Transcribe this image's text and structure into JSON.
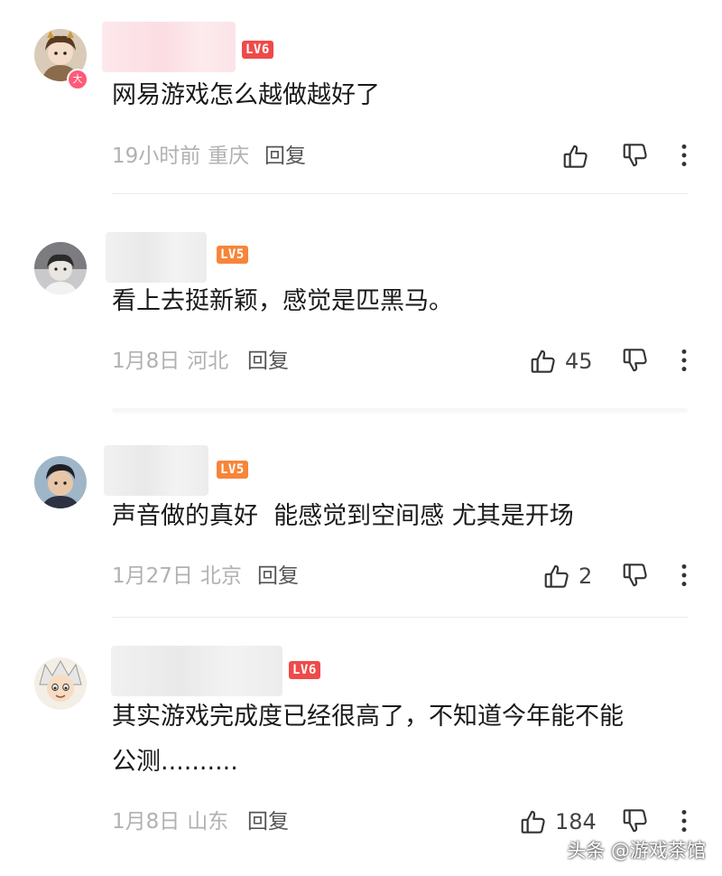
{
  "comments": [
    {
      "level": "LV6",
      "text": "网易游戏怎么越做越好了",
      "time": "19小时前",
      "location": "重庆",
      "reply_label": "回复",
      "likes": "",
      "avatar_badge": "大"
    },
    {
      "level": "LV5",
      "text": "看上去挺新颖，感觉是匹黑马。",
      "time": "1月8日",
      "location": "河北",
      "reply_label": "回复",
      "likes": "45"
    },
    {
      "level": "LV5",
      "text": "声音做的真好  能感觉到空间感 尤其是开场",
      "time": "1月27日",
      "location": "北京",
      "reply_label": "回复",
      "likes": "2"
    },
    {
      "level": "LV6",
      "text": "其实游戏完成度已经很高了，不知道今年能不能\n公测..........",
      "time": "1月8日",
      "location": "山东",
      "reply_label": "回复",
      "likes": "184"
    }
  ],
  "watermark": "头条 @游戏茶馆",
  "icons": {
    "like": "thumbs-up-icon",
    "dislike": "thumbs-down-icon",
    "more": "more-vertical-icon"
  },
  "colors": {
    "lv6_badge": "#ef4a4a",
    "lv5_badge": "#f7853a",
    "meta_text": "#b1b1b1"
  }
}
